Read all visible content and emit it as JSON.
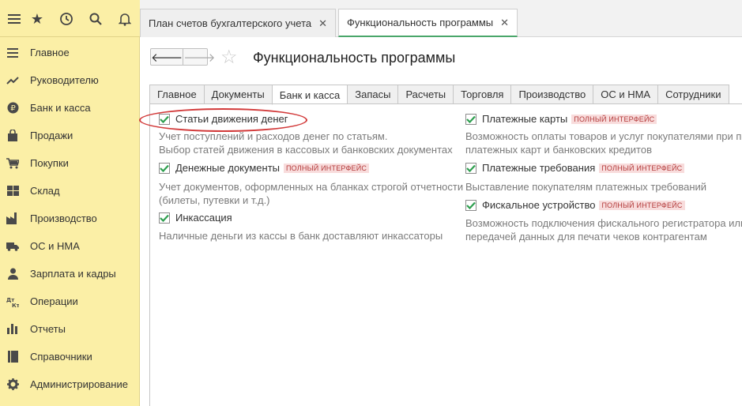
{
  "top_tabs": [
    {
      "label": "План счетов бухгалтерского учета",
      "close": "✕"
    },
    {
      "label": "Функциональность программы",
      "close": "✕"
    }
  ],
  "sidebar": {
    "items": [
      {
        "label": "Главное",
        "icon": "menu-icon"
      },
      {
        "label": "Руководителю",
        "icon": "trend-icon"
      },
      {
        "label": "Банк и касса",
        "icon": "ruble-icon"
      },
      {
        "label": "Продажи",
        "icon": "bag-icon"
      },
      {
        "label": "Покупки",
        "icon": "cart-icon"
      },
      {
        "label": "Склад",
        "icon": "warehouse-icon"
      },
      {
        "label": "Производство",
        "icon": "factory-icon"
      },
      {
        "label": "ОС и НМА",
        "icon": "truck-icon"
      },
      {
        "label": "Зарплата и кадры",
        "icon": "person-icon"
      },
      {
        "label": "Операции",
        "icon": "dt-kt-icon"
      },
      {
        "label": "Отчеты",
        "icon": "bar-chart-icon"
      },
      {
        "label": "Справочники",
        "icon": "book-icon"
      },
      {
        "label": "Администрирование",
        "icon": "gear-icon"
      }
    ]
  },
  "nav": {
    "back": "🡐",
    "forward": "🡒"
  },
  "page": {
    "title": "Функциональность программы",
    "star": "☆"
  },
  "section_tabs": [
    "Главное",
    "Документы",
    "Банк и касса",
    "Запасы",
    "Расчеты",
    "Торговля",
    "Производство",
    "ОС и НМА",
    "Сотрудники"
  ],
  "badge": "ПОЛНЫЙ ИНТЕРФЕЙС",
  "options_left": [
    {
      "label": "Статьи движения денег",
      "checked": true,
      "badge": false,
      "desc": [
        "Учет поступлений и расходов денег по статьям.",
        "Выбор статей движения в кассовых и банковских документах"
      ]
    },
    {
      "label": "Денежные документы",
      "checked": true,
      "badge": true,
      "desc": [
        "Учет документов, оформленных на бланках строгой отчетности",
        "(билеты, путевки и т.д.)"
      ]
    },
    {
      "label": "Инкассация",
      "checked": true,
      "badge": false,
      "desc": [
        "Наличные деньги из кассы в банк доставляют инкассаторы"
      ]
    }
  ],
  "options_right": [
    {
      "label": "Платежные карты",
      "checked": true,
      "badge": true,
      "desc": [
        "Возможность оплаты товаров и услуг покупателями при по",
        "платежных карт и банковских кредитов"
      ]
    },
    {
      "label": "Платежные требования",
      "checked": true,
      "badge": true,
      "desc": [
        "Выставление покупателям платежных требований"
      ]
    },
    {
      "label": "Фискальное устройство",
      "checked": true,
      "badge": true,
      "desc": [
        "Возможность подключения фискального регистратора или",
        "передачей данных для печати чеков контрагентам"
      ]
    }
  ]
}
